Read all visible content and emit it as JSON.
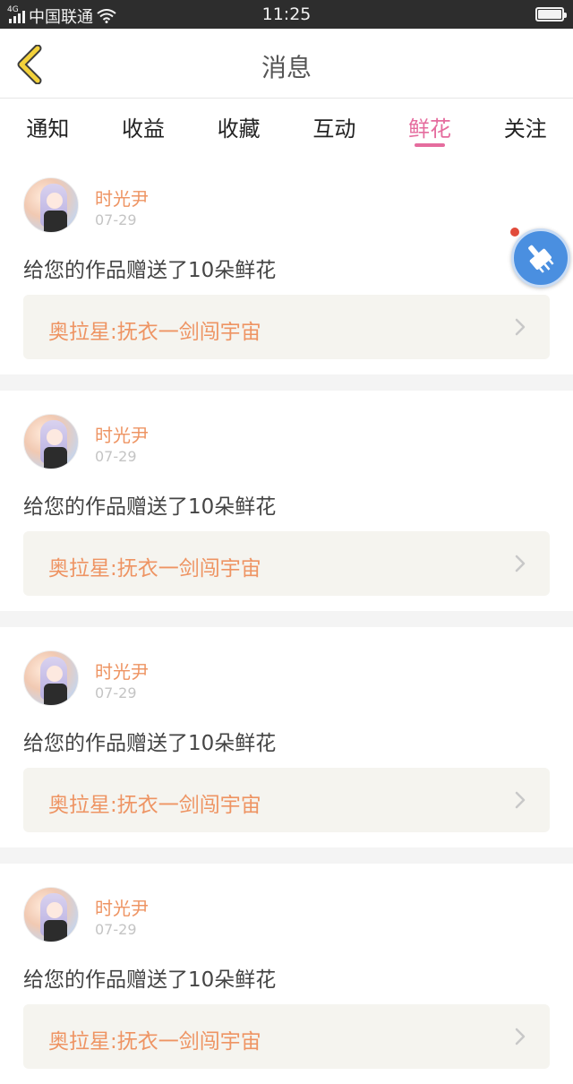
{
  "status_bar": {
    "network": "4G",
    "carrier": "中国联通",
    "time": "11:25"
  },
  "header": {
    "title": "消息"
  },
  "tabs": [
    {
      "label": "通知",
      "active": false
    },
    {
      "label": "收益",
      "active": false
    },
    {
      "label": "收藏",
      "active": false
    },
    {
      "label": "互动",
      "active": false
    },
    {
      "label": "鲜花",
      "active": true
    },
    {
      "label": "关注",
      "active": false
    }
  ],
  "messages": [
    {
      "user": "时光尹",
      "date": "07-29",
      "text": "给您的作品赠送了10朵鲜花",
      "work_title": "奥拉星:抚衣一剑闯宇宙"
    },
    {
      "user": "时光尹",
      "date": "07-29",
      "text": "给您的作品赠送了10朵鲜花",
      "work_title": "奥拉星:抚衣一剑闯宇宙"
    },
    {
      "user": "时光尹",
      "date": "07-29",
      "text": "给您的作品赠送了10朵鲜花",
      "work_title": "奥拉星:抚衣一剑闯宇宙"
    },
    {
      "user": "时光尹",
      "date": "07-29",
      "text": "给您的作品赠送了10朵鲜花",
      "work_title": "奥拉星:抚衣一剑闯宇宙"
    }
  ],
  "colors": {
    "accent_pink": "#e56c9e",
    "username_orange": "#ee9463",
    "float_button_blue": "#4a8fe0"
  }
}
